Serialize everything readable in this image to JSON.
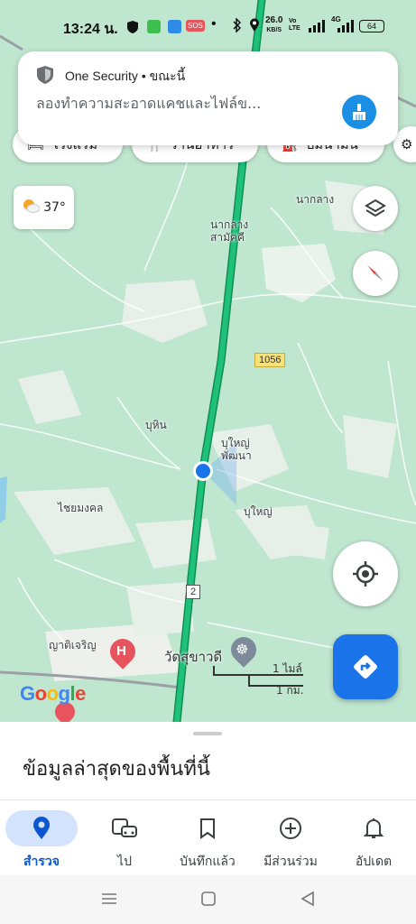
{
  "status_bar": {
    "time": "13:24 น.",
    "notification_badge": "SOS",
    "speed": "26.0",
    "speed_unit": "KB/S",
    "volte": "Vo LTE",
    "network": "4G",
    "battery": "64"
  },
  "notification": {
    "app_name": "One Security • ขณะนี้",
    "message": "ลองทำความสะอาดแคชและไฟล์ข..."
  },
  "chips": [
    {
      "label": "โรงแรม"
    },
    {
      "label": "ร้านอาหาร"
    },
    {
      "label": "ปั๊มน้ำมัน"
    }
  ],
  "weather": {
    "temp": "37°"
  },
  "map": {
    "labels": {
      "nakhlang_top": "นากลาง",
      "nakhlang_samakkhi_1": "นากลาง",
      "nakhlang_samakkhi_2": "สามัคคี",
      "buhin": "บุหิน",
      "buyai_phatthana_1": "บุใหญ่",
      "buyai_phatthana_2": "พัฒนา",
      "buyai": "บุใหญ่",
      "chaiyamongkhon": "ไชยมงคล",
      "yatcharoen": "ญาติเจริญ",
      "wat": "วัดสุขาวดี",
      "road_1056": "1056",
      "road_2": "2"
    },
    "scale": {
      "miles": "1 ไมล์",
      "km": "1 กม."
    },
    "logo": "Google"
  },
  "sheet": {
    "title": "ข้อมูลล่าสุดของพื้นที่นี้"
  },
  "bottom_nav": [
    {
      "label": "สำรวจ",
      "icon": "location-pin-icon",
      "active": true
    },
    {
      "label": "ไป",
      "icon": "commute-icon",
      "active": false
    },
    {
      "label": "บันทึกแล้ว",
      "icon": "bookmark-icon",
      "active": false
    },
    {
      "label": "มีส่วนร่วม",
      "icon": "add-circle-icon",
      "active": false
    },
    {
      "label": "อัปเดต",
      "icon": "bell-icon",
      "active": false
    }
  ],
  "colors": {
    "accent": "#1a73e8",
    "route": "#1db36b",
    "map_bg": "#bfe6cf"
  }
}
